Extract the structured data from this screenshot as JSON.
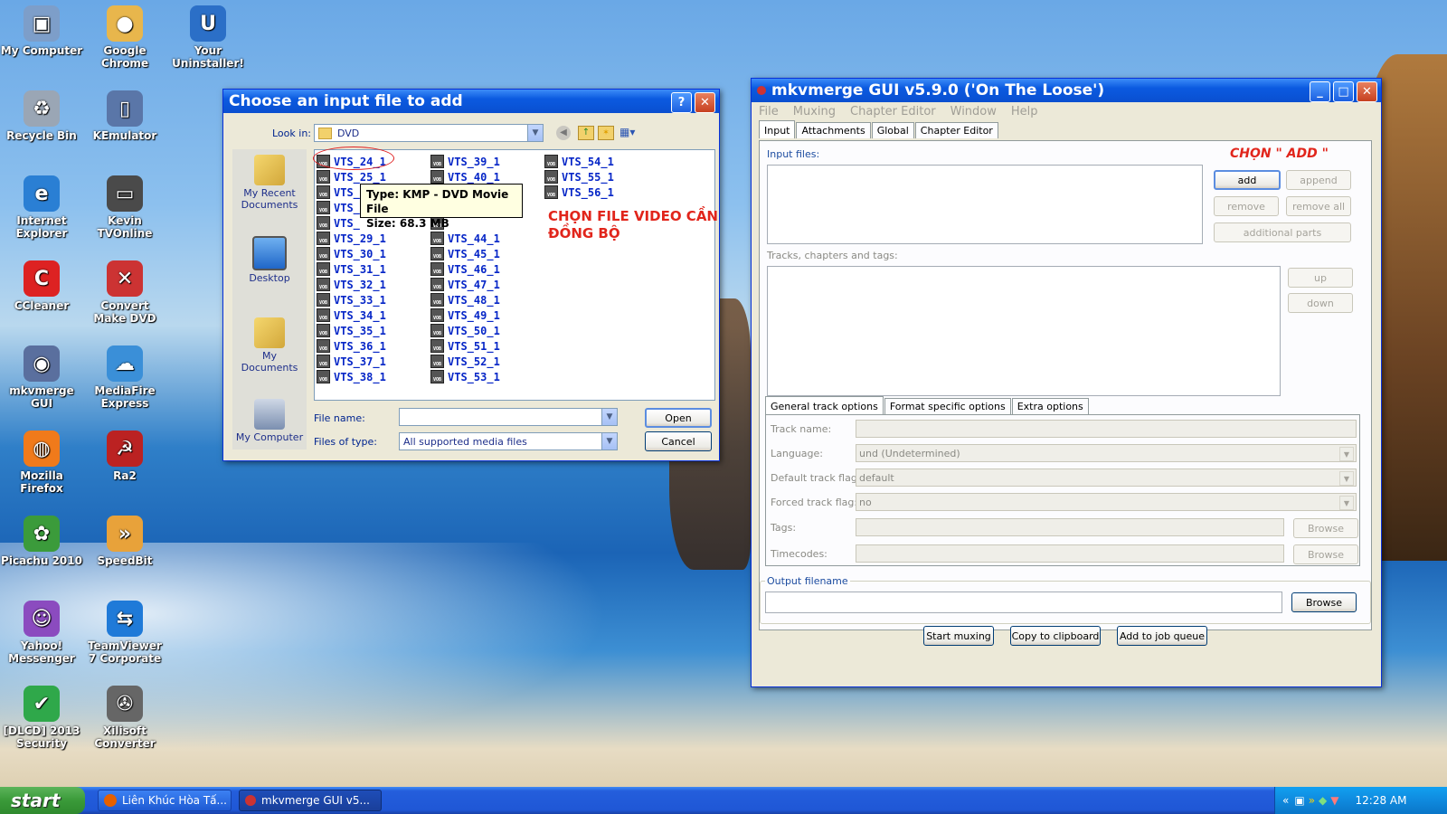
{
  "desktop": {
    "icons": [
      {
        "label": "My Computer",
        "name": "my-computer-icon"
      },
      {
        "label": "Google Chrome",
        "name": "google-chrome-icon"
      },
      {
        "label": "Your Uninstaller!",
        "name": "your-uninstaller-icon"
      },
      {
        "label": "Recycle Bin",
        "name": "recycle-bin-icon"
      },
      {
        "label": "KEmulator",
        "name": "kemulator-icon"
      },
      {
        "label": "Internet Explorer",
        "name": "internet-explorer-icon"
      },
      {
        "label": "Kevin TVOnline",
        "name": "kevin-tvonline-icon"
      },
      {
        "label": "CCleaner",
        "name": "ccleaner-icon"
      },
      {
        "label": "Convert Make DVD",
        "name": "convert-make-dvd-icon"
      },
      {
        "label": "mkvmerge GUI",
        "name": "mkvmerge-gui-icon"
      },
      {
        "label": "MediaFire Express",
        "name": "mediafire-express-icon"
      },
      {
        "label": "Mozilla Firefox",
        "name": "mozilla-firefox-icon"
      },
      {
        "label": "Ra2",
        "name": "ra2-icon"
      },
      {
        "label": "Picachu 2010",
        "name": "picachu-2010-icon"
      },
      {
        "label": "SpeedBit",
        "name": "speedbit-icon"
      },
      {
        "label": "Yahoo! Messenger",
        "name": "yahoo-messenger-icon"
      },
      {
        "label": "TeamViewer 7 Corporate",
        "name": "teamviewer-icon"
      },
      {
        "label": "[DLCD] 2013 Security",
        "name": "dlcd-security-icon"
      },
      {
        "label": "Xilisoft Converter",
        "name": "xilisoft-converter-icon"
      }
    ]
  },
  "dialog": {
    "title": "Choose an input file to add",
    "help": "?",
    "lookin_label": "Look in:",
    "lookin_value": "DVD",
    "places": [
      "My Recent Documents",
      "Desktop",
      "My Documents",
      "My Computer"
    ],
    "files_col1": [
      "VTS_24_1",
      "VTS_25_1",
      "VTS_2",
      "VTS_",
      "VTS_",
      "VTS_29_1",
      "VTS_30_1",
      "VTS_31_1",
      "VTS_32_1",
      "VTS_33_1",
      "VTS_34_1",
      "VTS_35_1",
      "VTS_36_1",
      "VTS_37_1",
      "VTS_38_1"
    ],
    "files_col2": [
      "VTS_39_1",
      "VTS_40_1",
      "",
      "",
      "",
      "VTS_44_1",
      "VTS_45_1",
      "VTS_46_1",
      "VTS_47_1",
      "VTS_48_1",
      "VTS_49_1",
      "VTS_50_1",
      "VTS_51_1",
      "VTS_52_1",
      "VTS_53_1"
    ],
    "files_col3": [
      "VTS_54_1",
      "VTS_55_1",
      "VTS_56_1"
    ],
    "file_icon_text": "VOB",
    "tooltip_type": "Type: KMP - DVD Movie File",
    "tooltip_size": "Size: 68.3 MB",
    "filename_label": "File name:",
    "filename_value": "",
    "filetype_label": "Files of type:",
    "filetype_value": "All supported media files",
    "open_label": "Open",
    "cancel_label": "Cancel"
  },
  "annotations": {
    "choose_file_line1": "CHỌN FILE VIDEO CẦN",
    "choose_file_line2": "ĐỒNG BỘ",
    "choose_add": "CHỌN \" ADD \""
  },
  "mkv": {
    "title": "mkvmerge GUI v5.9.0 ('On The Loose')",
    "menu": [
      "File",
      "Muxing",
      "Chapter Editor",
      "Window",
      "Help"
    ],
    "tabs": [
      "Input",
      "Attachments",
      "Global",
      "Chapter Editor"
    ],
    "input_files_label": "Input files:",
    "add": "add",
    "append": "append",
    "remove": "remove",
    "remove_all": "remove all",
    "additional_parts": "additional parts",
    "tracks_label": "Tracks, chapters and tags:",
    "up": "up",
    "down": "down",
    "track_tabs": [
      "General track options",
      "Format specific options",
      "Extra options"
    ],
    "track_name_label": "Track name:",
    "language_label": "Language:",
    "language_value": "und (Undetermined)",
    "default_flag_label": "Default track flag:",
    "default_flag_value": "default",
    "forced_flag_label": "Forced track flag:",
    "forced_flag_value": "no",
    "tags_label": "Tags:",
    "timecodes_label": "Timecodes:",
    "browse": "Browse",
    "output_label": "Output filename",
    "output_browse": "Browse",
    "start_muxing": "Start muxing",
    "copy_clipboard": "Copy to clipboard",
    "add_job": "Add to job queue"
  },
  "taskbar": {
    "start": "start",
    "tasks": [
      "Liên Khúc Hòa Tấ...",
      "mkvmerge GUI v5..."
    ],
    "clock": "12:28 AM"
  },
  "colors": {
    "xp_blue": "#0b5ae0",
    "annotation_red": "#e1251b",
    "file_link": "#0626c7"
  }
}
